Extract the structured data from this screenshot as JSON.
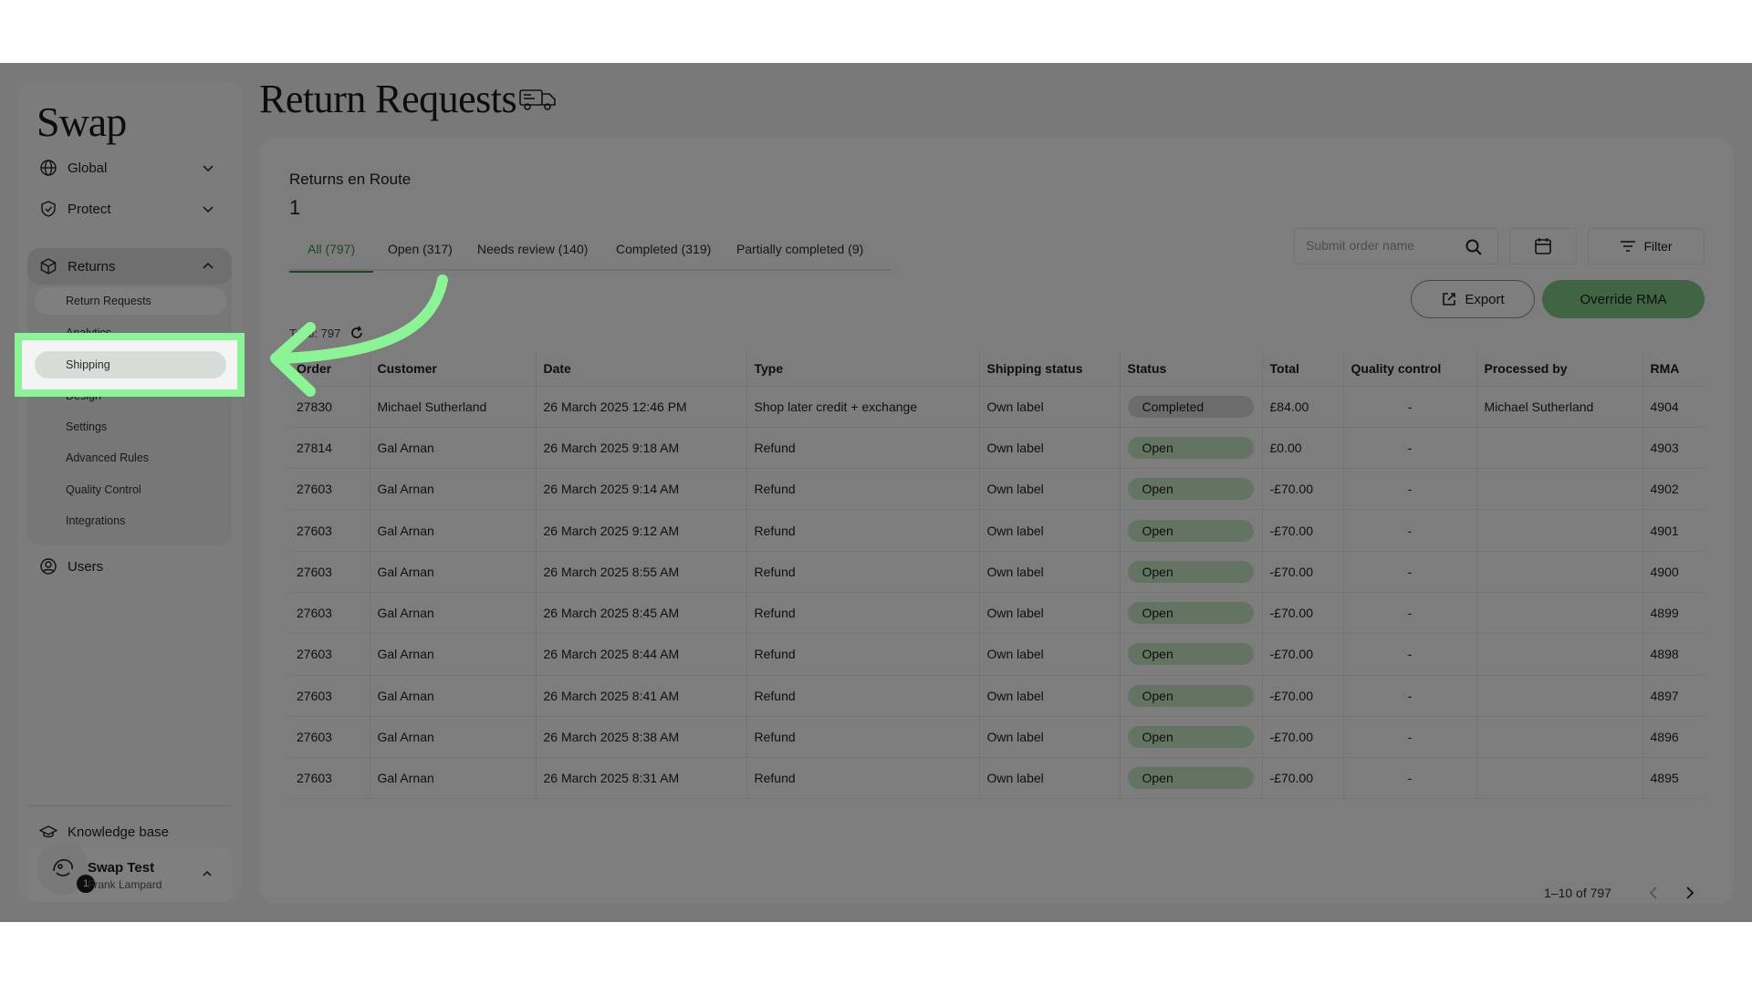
{
  "app": {
    "logo": "Swap"
  },
  "sidebar": {
    "items": [
      {
        "label": "Global"
      },
      {
        "label": "Protect"
      },
      {
        "label": "Returns"
      }
    ],
    "returns_sub": [
      "Return Requests",
      "Analytics",
      "Shipping",
      "Design",
      "Settings",
      "Advanced Rules",
      "Quality Control",
      "Integrations"
    ],
    "users": "Users",
    "knowledge": "Knowledge base",
    "user": {
      "name": "Swap Test",
      "sub": "Frank Lampard",
      "badge": "1"
    }
  },
  "page": {
    "title": "Return Requests"
  },
  "route": {
    "label": "Returns en Route",
    "count": "1"
  },
  "tabs": [
    "All (797)",
    "Open (317)",
    "Needs review (140)",
    "Completed (319)",
    "Partially completed (9)"
  ],
  "search": {
    "placeholder": "Submit order name"
  },
  "buttons": {
    "filter": "Filter",
    "export": "Export",
    "override": "Override RMA"
  },
  "total": "Total: 797",
  "table": {
    "headers": [
      "Order",
      "Customer",
      "Date",
      "Type",
      "Shipping status",
      "Status",
      "Total",
      "Quality control",
      "Processed by",
      "RMA"
    ],
    "rows": [
      [
        "27830",
        "Michael Sutherland",
        "26 March 2025 12:46 PM",
        "Shop later credit + exchange",
        "Own label",
        "Completed",
        "£84.00",
        "-",
        "Michael Sutherland",
        "4904"
      ],
      [
        "27814",
        "Gal Arnan",
        "26 March 2025 9:18 AM",
        "Refund",
        "Own label",
        "Open",
        "£0.00",
        "-",
        "",
        "4903"
      ],
      [
        "27603",
        "Gal Arnan",
        "26 March 2025 9:14 AM",
        "Refund",
        "Own label",
        "Open",
        "-£70.00",
        "-",
        "",
        "4902"
      ],
      [
        "27603",
        "Gal Arnan",
        "26 March 2025 9:12 AM",
        "Refund",
        "Own label",
        "Open",
        "-£70.00",
        "-",
        "",
        "4901"
      ],
      [
        "27603",
        "Gal Arnan",
        "26 March 2025 8:55 AM",
        "Refund",
        "Own label",
        "Open",
        "-£70.00",
        "-",
        "",
        "4900"
      ],
      [
        "27603",
        "Gal Arnan",
        "26 March 2025 8:45 AM",
        "Refund",
        "Own label",
        "Open",
        "-£70.00",
        "-",
        "",
        "4899"
      ],
      [
        "27603",
        "Gal Arnan",
        "26 March 2025 8:44 AM",
        "Refund",
        "Own label",
        "Open",
        "-£70.00",
        "-",
        "",
        "4898"
      ],
      [
        "27603",
        "Gal Arnan",
        "26 March 2025 8:41 AM",
        "Refund",
        "Own label",
        "Open",
        "-£70.00",
        "-",
        "",
        "4897"
      ],
      [
        "27603",
        "Gal Arnan",
        "26 March 2025 8:38 AM",
        "Refund",
        "Own label",
        "Open",
        "-£70.00",
        "-",
        "",
        "4896"
      ],
      [
        "27603",
        "Gal Arnan",
        "26 March 2025 8:31 AM",
        "Refund",
        "Own label",
        "Open",
        "-£70.00",
        "-",
        "",
        "4895"
      ]
    ]
  },
  "pagination": {
    "label": "1–10 of 797"
  },
  "colors": {
    "accent": "#3d8e45",
    "override": "#82c98b",
    "highlight": "#8cf497",
    "open_badge": "#c9e8c6"
  }
}
